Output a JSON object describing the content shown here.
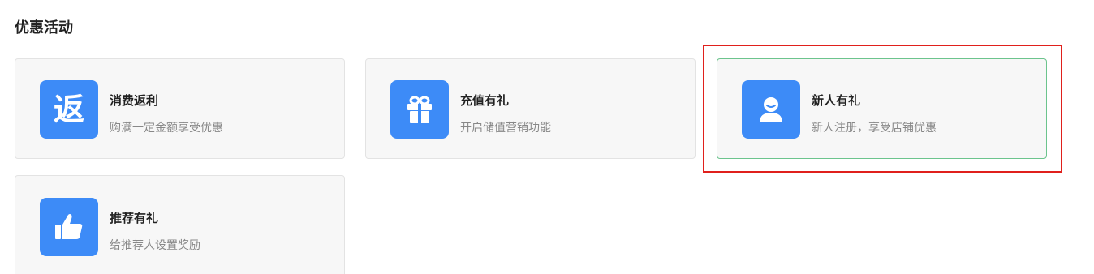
{
  "section": {
    "title": "优惠活动"
  },
  "cards": [
    {
      "title": "消费返利",
      "desc": "购满一定金额享受优惠",
      "icon": "rebate-icon",
      "icon_glyph": "返"
    },
    {
      "title": "充值有礼",
      "desc": "开启储值营销功能",
      "icon": "gift-icon"
    },
    {
      "title": "新人有礼",
      "desc": "新人注册，享受店铺优惠",
      "icon": "user-icon",
      "selected": true
    },
    {
      "title": "推荐有礼",
      "desc": "给推荐人设置奖励",
      "icon": "thumbs-up-icon"
    }
  ],
  "colors": {
    "icon_bg": "#3d8bf7",
    "selected_border": "#6cc48d",
    "highlight": "#e0201c"
  }
}
